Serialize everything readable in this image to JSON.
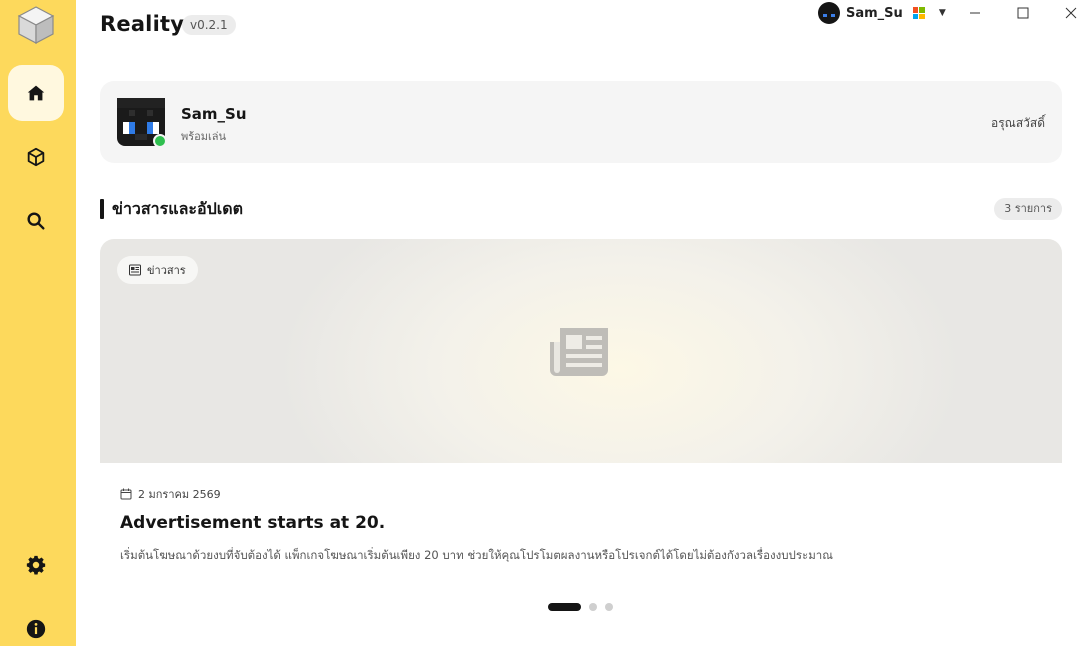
{
  "app": {
    "title": "Reality",
    "version": "v0.2.1"
  },
  "account": {
    "name": "Sam_Su"
  },
  "colors": {
    "sidebar": "#fdd95c",
    "online": "#2fbf4f",
    "accent_dark": "#151515"
  },
  "sidebar": {
    "items": [
      {
        "name": "home",
        "icon": "home-icon",
        "active": true
      },
      {
        "name": "packages",
        "icon": "cube-icon",
        "active": false
      },
      {
        "name": "search",
        "icon": "search-icon",
        "active": false
      },
      {
        "name": "settings",
        "icon": "gear-icon",
        "active": false
      },
      {
        "name": "info",
        "icon": "info-icon",
        "active": false
      }
    ]
  },
  "profile": {
    "name": "Sam_Su",
    "status": "พร้อมเล่น",
    "greeting": "อรุณสวัสดิ์"
  },
  "news_section": {
    "title": "ข่าวสารและอัปเดต",
    "count": "3 รายการ",
    "item": {
      "tag": "ข่าวสาร",
      "date": "2 มกราคม 2569",
      "title": "Advertisement starts at 20.",
      "description": "เริ่มต้นโฆษณาด้วยงบที่จับต้องได้ แพ็กเกจโฆษณาเริ่มต้นเพียง 20 บาท ช่วยให้คุณโปรโมตผลงานหรือโปรเจกต์ได้โดยไม่ต้องกังวลเรื่องงบประมาณ"
    },
    "carousel": {
      "total": 3,
      "active": 1
    }
  }
}
